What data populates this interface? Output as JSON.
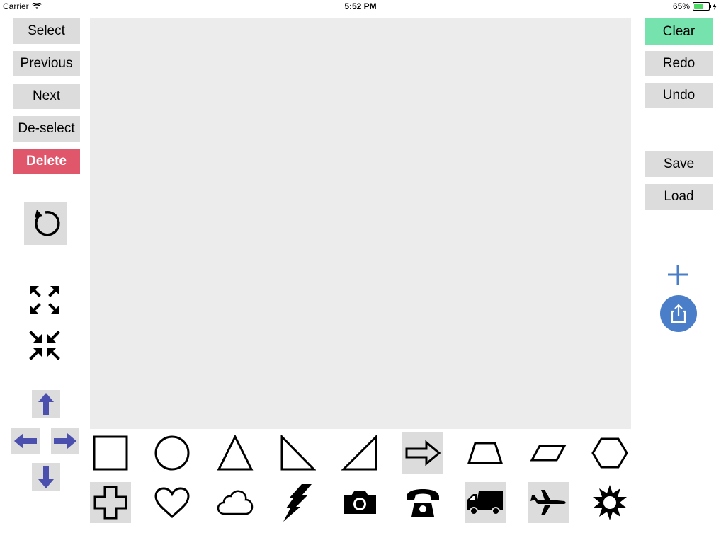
{
  "status_bar": {
    "carrier": "Carrier",
    "time": "5:52 PM",
    "battery": "65%",
    "battery_level": 0.65
  },
  "left_panel": {
    "select_label": "Select",
    "previous_label": "Previous",
    "next_label": "Next",
    "deselect_label": "De-select",
    "delete_label": "Delete"
  },
  "right_panel": {
    "clear_label": "Clear",
    "redo_label": "Redo",
    "undo_label": "Undo",
    "save_label": "Save",
    "load_label": "Load"
  },
  "colors": {
    "button_bg": "#dcdcdc",
    "clear_bg": "#76e2ae",
    "delete_bg": "#e0566b",
    "arrow_blue": "#4b4fae",
    "share_blue": "#4a7ec8",
    "canvas_bg": "#ececec"
  },
  "icons": {
    "left": [
      "rotate-icon",
      "expand-icon",
      "shrink-icon",
      "move-up-icon",
      "move-left-icon",
      "move-right-icon",
      "move-down-icon"
    ],
    "right": [
      "add-icon",
      "share-icon"
    ]
  },
  "shape_palette": {
    "row1": [
      "square",
      "circle",
      "triangle",
      "right-triangle",
      "right-triangle-mirrored",
      "arrow",
      "trapezoid",
      "parallelogram",
      "hexagon"
    ],
    "row2": [
      "cross",
      "heart",
      "cloud",
      "lightning",
      "camera",
      "telephone",
      "truck",
      "airplane",
      "sun"
    ],
    "selected": [
      "arrow",
      "cross",
      "truck",
      "airplane"
    ]
  }
}
